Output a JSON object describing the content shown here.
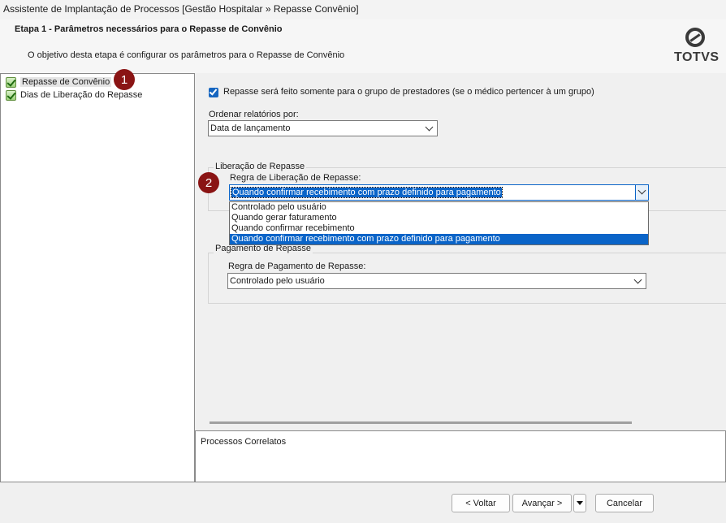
{
  "window": {
    "title": "Assistente de Implantação de Processos [Gestão Hospitalar » Repasse Convênio]"
  },
  "header": {
    "step_title": "Etapa 1 - Parâmetros necessários para o Repasse de Convênio",
    "step_description": "O objetivo desta etapa é configurar os parâmetros para o Repasse de Convênio",
    "logo_text": "TOTVS"
  },
  "sidebar": {
    "items": [
      {
        "label": "Repasse de Convênio",
        "icon": "green-check-icon",
        "selected": true
      },
      {
        "label": "Dias de Liberação do Repasse",
        "icon": "green-check-icon",
        "selected": false
      }
    ]
  },
  "annotations": {
    "badge1": "1",
    "badge2": "2"
  },
  "main": {
    "checkbox_label": "Repasse será feito somente para o grupo de prestadores (se o médico pertencer à um grupo)",
    "checkbox_checked": true,
    "order_label": "Ordenar relatórios por:",
    "order_value": "Data de lançamento",
    "liberacao": {
      "group_title": "Liberação de Repasse",
      "rule_label": "Regra de Liberação de Repasse:",
      "rule_value": "Quando confirmar recebimento com prazo definido para pagamento",
      "options": [
        "Controlado pelo usuário",
        "Quando gerar faturamento",
        "Quando confirmar recebimento",
        "Quando confirmar recebimento com prazo definido para pagamento"
      ],
      "selected_index": 3
    },
    "pagamento": {
      "group_title": "Pagamento de Repasse",
      "rule_label": "Regra de Pagamento de Repasse:",
      "rule_value": "Controlado pelo usuário"
    }
  },
  "related": {
    "title": "Processos Correlatos"
  },
  "buttons": {
    "back": "< Voltar",
    "next": "Avançar >",
    "cancel": "Cancelar"
  },
  "colors": {
    "accent": "#0a64c8",
    "badge": "#8a1414",
    "checkbox": "#1565c0"
  }
}
